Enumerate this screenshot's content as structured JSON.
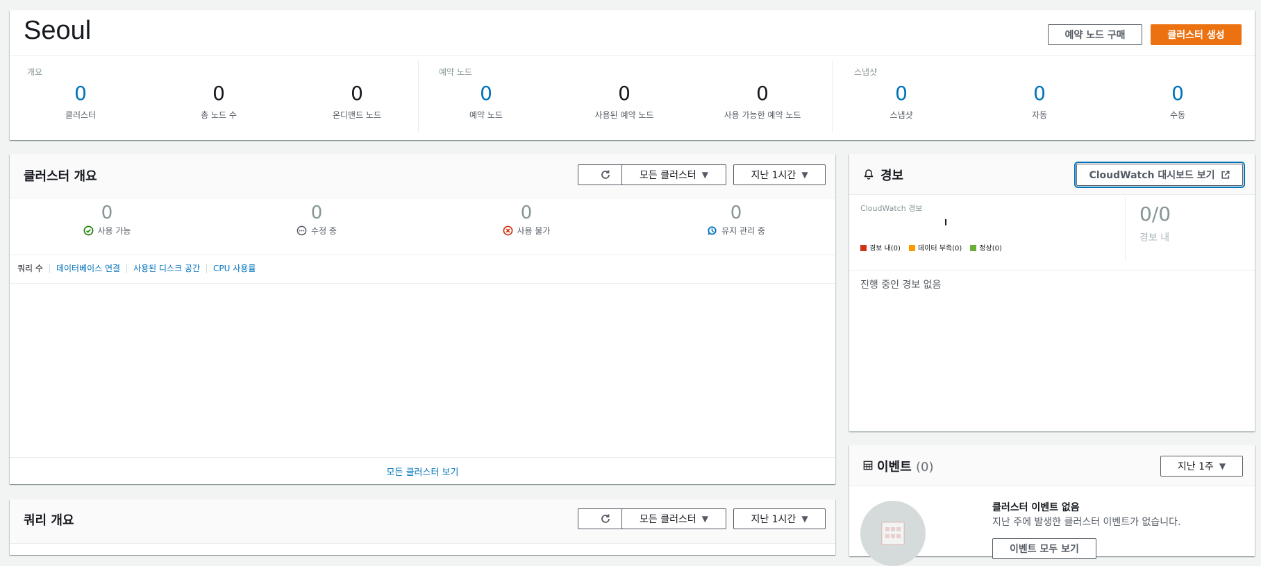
{
  "region": {
    "title": "Seoul",
    "buttons": {
      "reserve": "예약 노드 구매",
      "create": "클러스터 생성"
    }
  },
  "summary": {
    "overview": {
      "label": "개요",
      "metrics": [
        {
          "value": "0",
          "label": "클러스터"
        },
        {
          "value": "0",
          "label": "총 노드 수"
        },
        {
          "value": "0",
          "label": "온디맨드 노드"
        }
      ]
    },
    "reserved": {
      "label": "예약 노드",
      "metrics": [
        {
          "value": "0",
          "label": "예약 노드"
        },
        {
          "value": "0",
          "label": "사용된 예약 노드"
        },
        {
          "value": "0",
          "label": "사용 가능한 예약 노드"
        }
      ]
    },
    "snapshots": {
      "label": "스냅샷",
      "metrics": [
        {
          "value": "0",
          "label": "스냅샷"
        },
        {
          "value": "0",
          "label": "자동"
        },
        {
          "value": "0",
          "label": "수동"
        }
      ]
    }
  },
  "cluster_overview": {
    "title": "클러스터 개요",
    "filter": "모든 클러스터",
    "range": "지난 1시간",
    "statuses": [
      {
        "value": "0",
        "label": "사용 가능",
        "icon": "check-circle-icon",
        "color": "#1d8102"
      },
      {
        "value": "0",
        "label": "수정 중",
        "icon": "ellipsis-circle-icon",
        "color": "#545b64"
      },
      {
        "value": "0",
        "label": "사용 불가",
        "icon": "x-circle-icon",
        "color": "#d13212"
      },
      {
        "value": "0",
        "label": "유지 관리 중",
        "icon": "maintenance-icon",
        "color": "#0073bb"
      }
    ],
    "tabs": [
      "쿼리 수",
      "데이터베이스 연결",
      "사용된 디스크 공간",
      "CPU 사용률"
    ],
    "view_all": "모든 클러스터 보기"
  },
  "query_overview": {
    "title": "쿼리 개요",
    "filter": "모든 클러스터",
    "range": "지난 1시간"
  },
  "alarms": {
    "title": "경보",
    "cloudwatch_button": "CloudWatch 대시보드 보기",
    "chart_label": "CloudWatch 경보",
    "legend": [
      {
        "label": "경보 내(0)",
        "color": "#d13212"
      },
      {
        "label": "데이터 부족(0)",
        "color": "#ff9900"
      },
      {
        "label": "정상(0)",
        "color": "#6aaf35"
      }
    ],
    "ratio": "0/0",
    "ratio_label": "경보 내",
    "empty": "진행 중인 경보 없음"
  },
  "events": {
    "title": "이벤트",
    "count": "(0)",
    "range": "지난 1주",
    "empty_title": "클러스터 이벤트 없음",
    "empty_desc": "지난 주에 발생한 클러스터 이벤트가 없습니다.",
    "view_all": "이벤트 모두 보기"
  }
}
